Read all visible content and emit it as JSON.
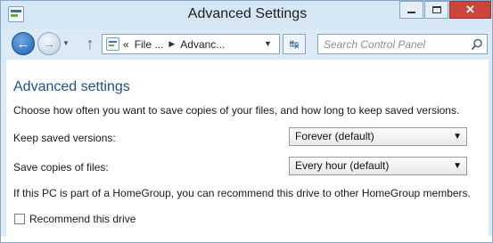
{
  "window": {
    "title": "Advanced Settings",
    "controls": {
      "minimize": "minimize",
      "maximize": "maximize",
      "close": "✕"
    }
  },
  "nav": {
    "back_icon": "back-arrow-icon",
    "forward_icon": "forward-arrow-icon",
    "up_icon": "up-arrow-icon",
    "breadcrumb": {
      "overflow": "«",
      "items": [
        "File ...",
        "Advanc..."
      ]
    },
    "search": {
      "placeholder": "Search Control Panel"
    }
  },
  "content": {
    "heading": "Advanced settings",
    "description": "Choose how often you want to save copies of your files, and how long to keep saved versions.",
    "keep_versions": {
      "label": "Keep saved versions:",
      "value": "Forever (default)"
    },
    "save_copies": {
      "label": "Save copies of files:",
      "value": "Every hour (default)"
    },
    "homegroup_text": "If this PC is part of a HomeGroup, you can recommend this drive to other HomeGroup members.",
    "recommend": {
      "label": "Recommend this drive",
      "checked": false
    }
  },
  "colors": {
    "heading": "#1e4f8f",
    "titlebar": "#d5e6f4",
    "close_button": "#c9463d"
  }
}
